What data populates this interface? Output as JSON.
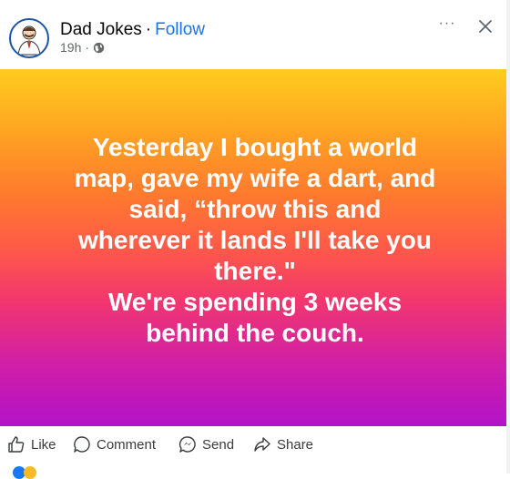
{
  "post": {
    "page_name": "Dad Jokes",
    "separator": "·",
    "follow_label": "Follow",
    "time": "19h",
    "meta_separator": "·",
    "privacy_icon": "globe-icon",
    "more_icon": "more-options-icon",
    "more_label": "···",
    "close_icon": "close-icon",
    "text_lines": [
      "Yesterday I bought a world",
      "map, gave my wife a dart, and",
      "said, “throw this and",
      "wherever it lands I'll take you",
      "there.\"",
      "We're spending 3 weeks",
      "behind the couch."
    ]
  },
  "actions": {
    "like_label": "Like",
    "comment_label": "Comment",
    "send_label": "Send",
    "share_label": "Share"
  },
  "colors": {
    "follow": "#1b74e4",
    "gradient_top": "#ffcc1e",
    "gradient_bottom": "#b212c9",
    "text": "#ffffff"
  }
}
